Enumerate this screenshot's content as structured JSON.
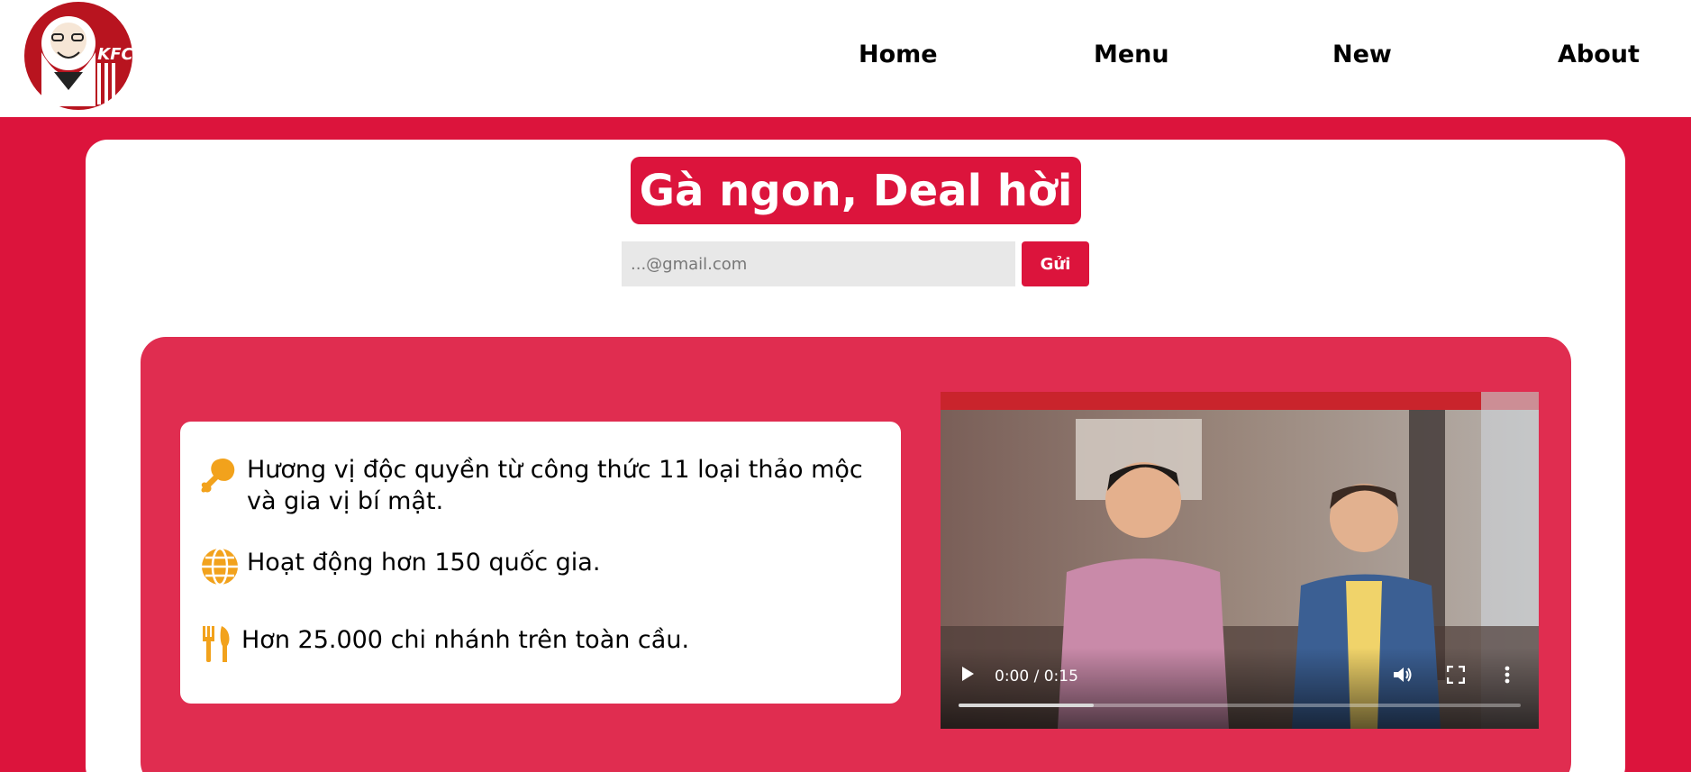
{
  "header": {
    "logo_text": "KFC",
    "nav": [
      {
        "label": "Home"
      },
      {
        "label": "Menu"
      },
      {
        "label": "New"
      },
      {
        "label": "About"
      }
    ]
  },
  "hero": {
    "title": "Gà ngon, Deal hời",
    "email_placeholder": "...@gmail.com",
    "send_label": "Gửi"
  },
  "features": [
    {
      "icon": "chicken-drumstick-icon",
      "text": "Hương vị độc quyền từ công thức 11 loại thảo mộc và gia vị bí mật."
    },
    {
      "icon": "globe-icon",
      "text": "Hoạt động hơn 150 quốc gia."
    },
    {
      "icon": "fork-knife-icon",
      "text": "Hơn 25.000 chi nhánh trên toàn cầu."
    }
  ],
  "video": {
    "time": "0:00 / 0:15",
    "progress": 0.24
  },
  "colors": {
    "brand_red": "#dc143c",
    "panel_red": "#e02d50",
    "icon_gold": "#f2a21c"
  }
}
